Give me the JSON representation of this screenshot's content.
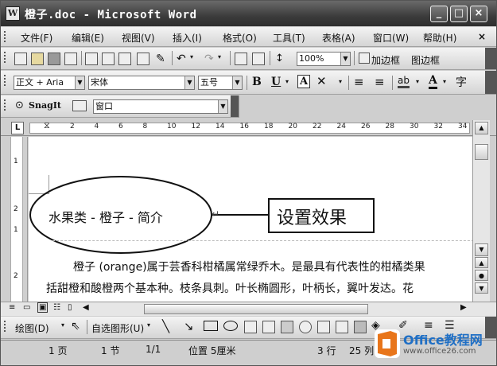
{
  "window": {
    "title": "橙子.doc - Microsoft Word",
    "app_icon": "W",
    "buttons": [
      "_",
      "□",
      "×"
    ]
  },
  "menu": [
    "文件(F)",
    "编辑(E)",
    "视图(V)",
    "插入(I)",
    "格式(O)",
    "工具(T)",
    "表格(A)",
    "窗口(W)",
    "帮助(H)"
  ],
  "menu_close": "×",
  "standard": {
    "zoom": "100%",
    "add_frame": "加边框",
    "page_border": "图边框"
  },
  "formatting": {
    "style": "正文 + Aria",
    "font": "宋体",
    "size": "五号",
    "bold": "B",
    "underline": "U",
    "font_color": "A"
  },
  "snagit": {
    "label": "SnagIt",
    "target": "窗口"
  },
  "ruler": {
    "ticks": [
      "2",
      "4",
      "6",
      "8",
      "10",
      "12",
      "14",
      "16",
      "18",
      "20",
      "22",
      "24",
      "26",
      "28",
      "30",
      "32",
      "34"
    ],
    "tab_marker": "L"
  },
  "vruler_ticks": [
    "1",
    "2",
    "1",
    "2"
  ],
  "document": {
    "heading": "水果类 - 橙子 - 简介",
    "callout": "设置效果",
    "para_line1": "橙子 (orange)属于芸香科柑橘属常绿乔木。是最具有代表性的柑橘类果",
    "para_line2": "括甜橙和酸橙两个基本种。枝条具刺。叶长椭圆形，叶柄长，翼叶发达。花"
  },
  "drawing": {
    "draw": "绘图(D)",
    "autoshapes": "自选图形(U)"
  },
  "status": {
    "page": "1 页",
    "section": "1 节",
    "pages": "1/1",
    "position": "位置 5厘米",
    "line": "3 行",
    "col": "25 列"
  },
  "watermark": {
    "brand": "Office教程网",
    "url": "www.office26.com"
  },
  "colors": {
    "title_bar": "#3c3c3c",
    "watermark_orange": "#e8751a",
    "watermark_blue": "#1f6fc5"
  }
}
